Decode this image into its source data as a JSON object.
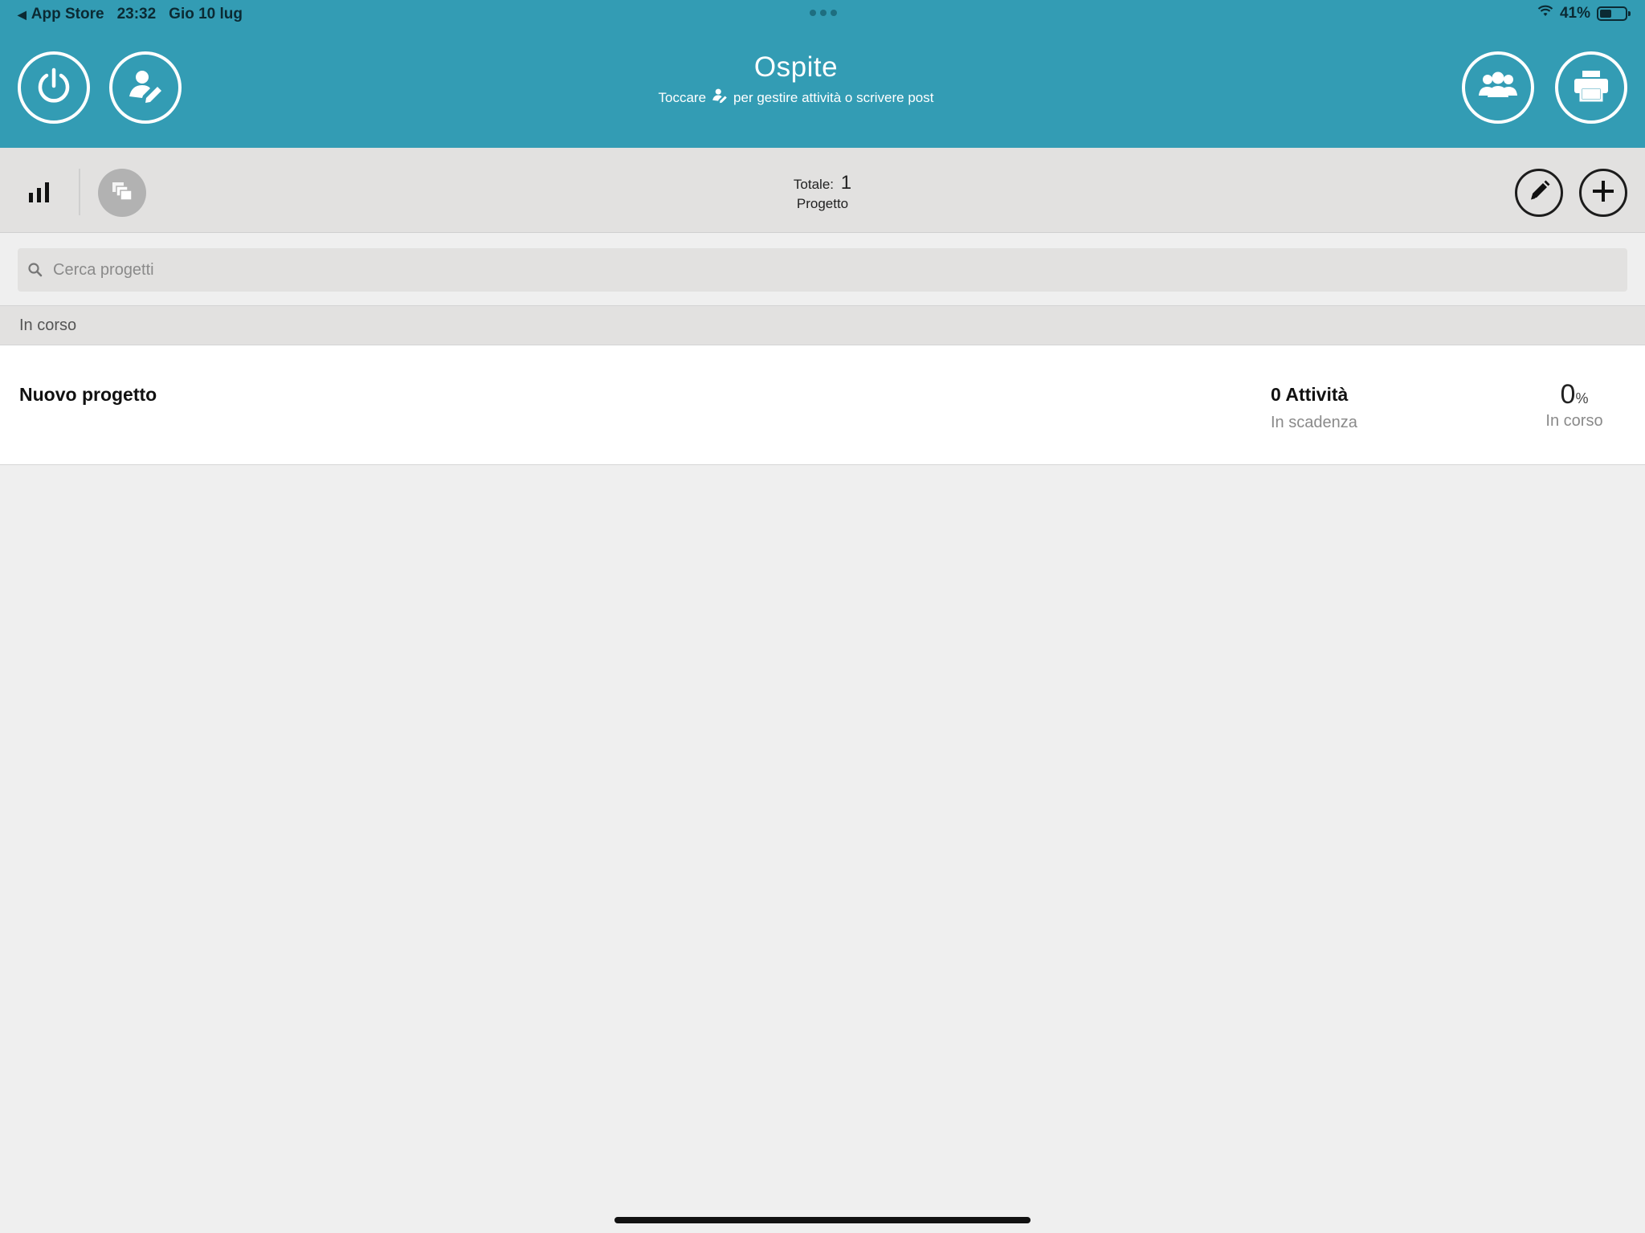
{
  "status_bar": {
    "back_app": "App Store",
    "time": "23:32",
    "date": "Gio 10 lug",
    "battery": "41%"
  },
  "header": {
    "title": "Ospite",
    "subtitle_before": "Toccare",
    "subtitle_after": "per gestire attività o scrivere post",
    "background_color": "#339cb4",
    "left_buttons": [
      "power-icon",
      "user-edit-icon"
    ],
    "right_buttons": [
      "group-icon",
      "printer-icon"
    ]
  },
  "toolbar": {
    "total_label": "Totale:",
    "total_count": "1",
    "total_unit": "Progetto",
    "left_icons": [
      "bar-chart-icon",
      "copy-icon"
    ],
    "right_icons": [
      "pencil-icon",
      "plus-icon"
    ]
  },
  "search": {
    "placeholder": "Cerca progetti",
    "value": ""
  },
  "sections": [
    {
      "title": "In corso",
      "projects": [
        {
          "name": "Nuovo progetto",
          "tasks_count": "0 Attività",
          "tasks_status": "In scadenza",
          "percent_value": "0",
          "percent_sign": "%",
          "percent_status": "In corso"
        }
      ]
    }
  ]
}
